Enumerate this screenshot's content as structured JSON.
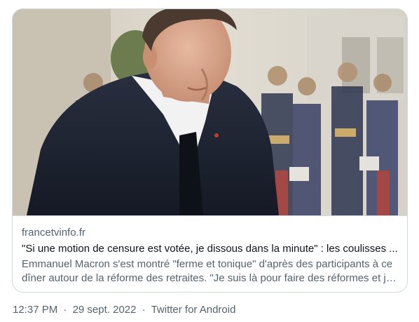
{
  "card": {
    "image_alt": "Emmanuel Macron",
    "domain": "francetvinfo.fr",
    "headline": "\"Si une motion de censure est votée, je dissous dans la minute\" : les coulisses ...",
    "description_line1": "Emmanuel Macron s'est montré \"ferme et tonique\" d'après des participants à ce",
    "description_line2": "dîner autour de la réforme des retraites. \"Je suis là pour faire des réformes et je..."
  },
  "footer": {
    "time": "12:37 PM",
    "separator": "·",
    "date": "29 sept. 2022",
    "client": "Twitter for Android"
  },
  "colors": {
    "border": "#cfd9de",
    "secondary_text": "#536471",
    "primary_text": "#0f1419"
  }
}
